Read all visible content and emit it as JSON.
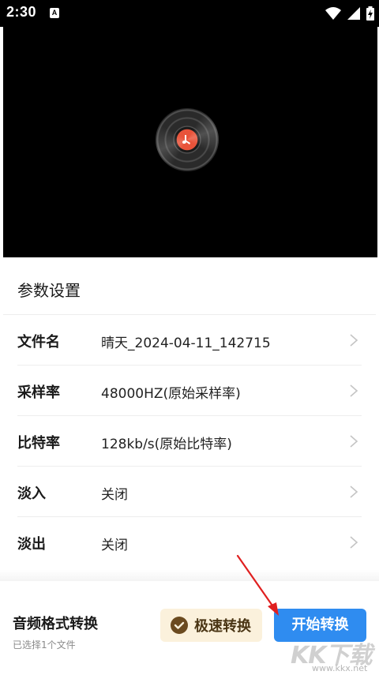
{
  "status_bar": {
    "time": "2:30",
    "notification_badge": "A",
    "icons": [
      "wifi-icon",
      "signal-icon",
      "battery-charging-icon"
    ]
  },
  "player": {
    "icon": "vinyl-disc-icon",
    "accent_color": "#e8533a"
  },
  "params": {
    "title": "参数设置",
    "rows": [
      {
        "label": "文件名",
        "value": "晴天_2024-04-11_142715"
      },
      {
        "label": "采样率",
        "value": "48000HZ(原始采样率)"
      },
      {
        "label": "比特率",
        "value": "128kb/s(原始比特率)"
      },
      {
        "label": "淡入",
        "value": "关闭"
      },
      {
        "label": "淡出",
        "value": "关闭"
      }
    ]
  },
  "bottom": {
    "title": "音频格式转换",
    "subtitle": "已选择1个文件",
    "fast_button": "极速转换",
    "start_button": "开始转换",
    "primary_color": "#2f8cf0",
    "fast_bg_color": "#fbf1dc"
  },
  "watermark": {
    "text": "KK下载",
    "url": "www.kkx.net"
  }
}
